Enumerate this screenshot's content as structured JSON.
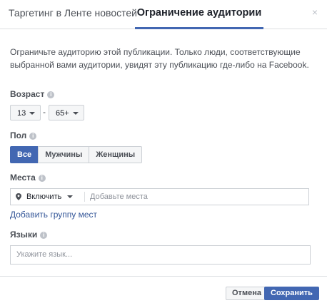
{
  "tabs": [
    {
      "label": "Таргетинг в Ленте новостей"
    },
    {
      "label": "Ограничение аудитории"
    }
  ],
  "close_glyph": "×",
  "description": "Ограничьте аудиторию этой публикации. Только люди, соответствующие выбранной вами аудитории, увидят эту публикацию где-либо на Facebook.",
  "age": {
    "label": "Возраст",
    "min": "13",
    "separator": "-",
    "max": "65+"
  },
  "gender": {
    "label": "Пол",
    "options": [
      "Все",
      "Мужчины",
      "Женщины"
    ],
    "selected": "Все"
  },
  "places": {
    "label": "Места",
    "mode": "Включить",
    "placeholder": "Добавьте места",
    "add_group_link": "Добавить группу мест",
    "pin_icon": "location-pin-icon"
  },
  "languages": {
    "label": "Языки",
    "placeholder": "Укажите язык..."
  },
  "info_glyph": "i",
  "buttons": {
    "cancel": "Отмена",
    "save": "Сохранить"
  },
  "colors": {
    "accent": "#4267b2",
    "link": "#365899",
    "border": "#ccd0d5"
  }
}
